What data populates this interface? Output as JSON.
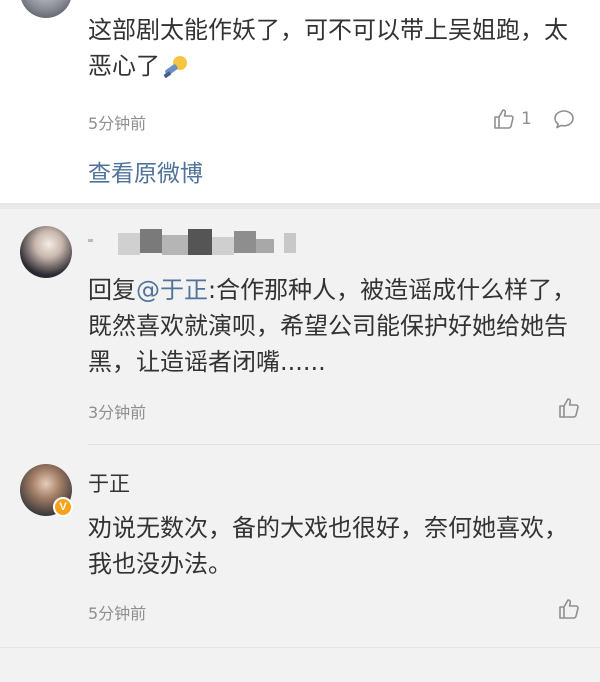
{
  "top_comment": {
    "text": "这部剧太能作妖了，可不可以带上吴姐跑，太恶心了",
    "time": "5分钟前",
    "like_count": "1",
    "view_original": "查看原微博"
  },
  "replies": [
    {
      "reply_prefix": "回复",
      "mention": "@于正",
      "text": ":合作那种人，被造谣成什么样了，既然喜欢就演呗，希望公司能保护好她给她告黑，让造谣者闭嘴......",
      "time": "3分钟前"
    },
    {
      "username": "于正",
      "badge": "V",
      "text": "劝说无数次，备的大戏也很好，奈何她喜欢，我也没办法。",
      "time": "5分钟前"
    }
  ],
  "icons": {
    "like": "thumbs-up-icon",
    "comment": "comment-bubble-icon",
    "emoji": "mic-emoji-icon"
  },
  "colors": {
    "link": "#50739a",
    "badge": "#f7a21b",
    "meta": "#8f8f8f"
  }
}
